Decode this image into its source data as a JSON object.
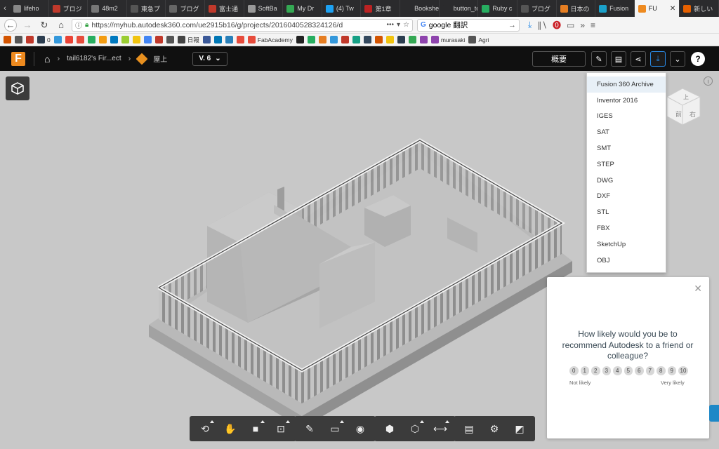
{
  "browser": {
    "tabs": [
      {
        "label": "lifeho",
        "color": "#888"
      },
      {
        "label": "ブロジ",
        "color": "#c0392b"
      },
      {
        "label": "48m2",
        "color": "#777"
      },
      {
        "label": "東急プ",
        "color": "#555"
      },
      {
        "label": "ブログ",
        "color": "#666"
      },
      {
        "label": "富士通",
        "color": "#c0392b"
      },
      {
        "label": "SoftBa",
        "color": "#999"
      },
      {
        "label": "My Dr",
        "color": "#34a853"
      },
      {
        "label": "(4) Tw",
        "color": "#1da1f2"
      },
      {
        "label": "第1章",
        "color": "#b22"
      },
      {
        "label": "Bookshelf",
        "color": "#2b2b2d"
      },
      {
        "label": "button_to",
        "color": "#2b2b2d"
      },
      {
        "label": "Ruby c",
        "color": "#27ae60"
      },
      {
        "label": "ブログ",
        "color": "#555"
      },
      {
        "label": "日本の",
        "color": "#e67e22"
      },
      {
        "label": "Fusion",
        "color": "#1aa0c9"
      },
      {
        "label": "FU",
        "color": "#ee8a1f",
        "active": true
      },
      {
        "label": "新しい",
        "color": "#e66000"
      }
    ],
    "url": "https://myhub.autodesk360.com/ue2915b16/g/projects/20160405283241​26/d",
    "search_value": "google 翻訳",
    "bookmarks": [
      {
        "label": "",
        "color": "#d35400"
      },
      {
        "label": "",
        "color": "#555"
      },
      {
        "label": "",
        "color": "#c0392b"
      },
      {
        "label": "0",
        "color": "#2c3e50"
      },
      {
        "label": "",
        "color": "#3498db"
      },
      {
        "label": "",
        "color": "#ea4335"
      },
      {
        "label": "",
        "color": "#e74c3c"
      },
      {
        "label": "",
        "color": "#27ae60"
      },
      {
        "label": "",
        "color": "#f39c12"
      },
      {
        "label": "",
        "color": "#0079bf"
      },
      {
        "label": "",
        "color": "#9acd32"
      },
      {
        "label": "",
        "color": "#f1c40f"
      },
      {
        "label": "",
        "color": "#4285f4"
      },
      {
        "label": "",
        "color": "#c0392b"
      },
      {
        "label": "",
        "color": "#555"
      },
      {
        "label": "日報",
        "color": "#444"
      },
      {
        "label": "",
        "color": "#3b5998"
      },
      {
        "label": "",
        "color": "#0077b5"
      },
      {
        "label": "",
        "color": "#2980b9"
      },
      {
        "label": "",
        "color": "#e74c3c"
      },
      {
        "label": "FabAcademy",
        "color": "#e74c3c"
      },
      {
        "label": "",
        "color": "#222"
      },
      {
        "label": "",
        "color": "#27ae60"
      },
      {
        "label": "",
        "color": "#e67e22"
      },
      {
        "label": "",
        "color": "#3498db"
      },
      {
        "label": "",
        "color": "#c0392b"
      },
      {
        "label": "",
        "color": "#16a085"
      },
      {
        "label": "",
        "color": "#34495e"
      },
      {
        "label": "",
        "color": "#d35400"
      },
      {
        "label": "",
        "color": "#f1c40f"
      },
      {
        "label": "",
        "color": "#2c3e50"
      },
      {
        "label": "",
        "color": "#34a853"
      },
      {
        "label": "",
        "color": "#8e44ad"
      },
      {
        "label": "murasaki",
        "color": "#8e44ad"
      },
      {
        "label": "Agri",
        "color": "#555"
      }
    ]
  },
  "app": {
    "breadcrumb_project": "tail6182's Fir...ect",
    "breadcrumb_item": "屋上",
    "version": "V. 6",
    "overview_label": "概要",
    "accent": "#2b8be6",
    "brand": "#ee8a1f"
  },
  "download_menu": {
    "items": [
      "Fusion 360 Archive",
      "Inventor 2016",
      "IGES",
      "SAT",
      "SMT",
      "STEP",
      "DWG",
      "DXF",
      "STL",
      "FBX",
      "SketchUp",
      "OBJ"
    ],
    "highlighted": "Fusion 360 Archive"
  },
  "navcube": {
    "front_label": "前",
    "right_label": "右",
    "top_label": "上"
  },
  "survey": {
    "question": "How likely would you be to recommend Autodesk to a friend or colleague?",
    "scale": [
      "0",
      "1",
      "2",
      "3",
      "4",
      "5",
      "6",
      "7",
      "8",
      "9",
      "10"
    ],
    "low_label": "Not likely",
    "high_label": "Very likely"
  },
  "toolbar_groups": [
    [
      "orbit-icon",
      "pan-icon",
      "camera-icon",
      "fit-icon"
    ],
    [
      "markup-icon",
      "comment-icon",
      "visibility-icon"
    ],
    [
      "section-icon",
      "explode-icon",
      "measure-icon"
    ],
    [
      "model-browser-icon",
      "settings-icon",
      "fullscreen-icon"
    ]
  ]
}
